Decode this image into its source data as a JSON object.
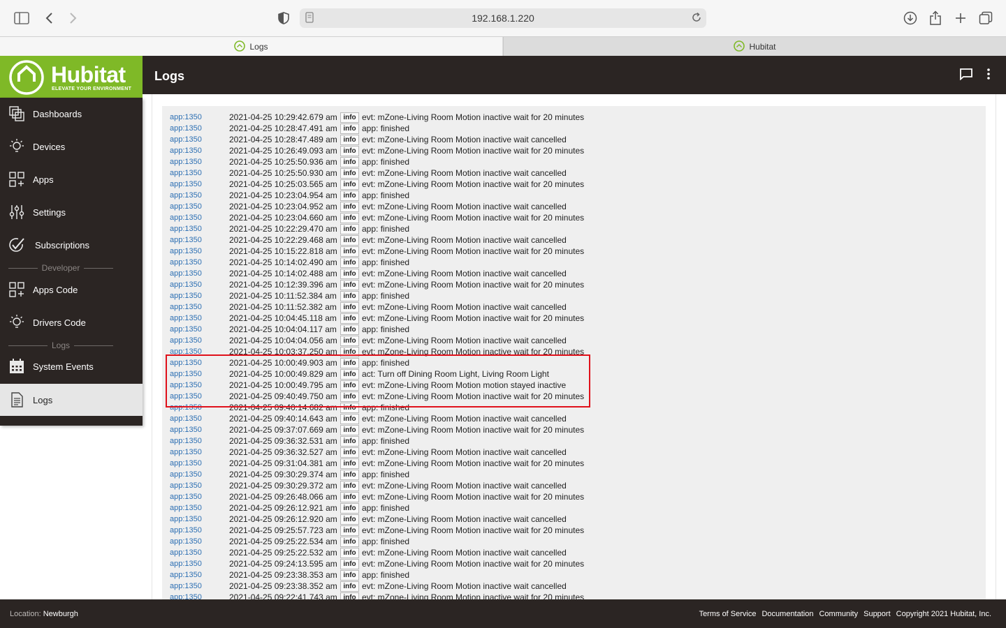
{
  "browser": {
    "url": "192.168.1.220",
    "tabs": [
      {
        "label": "Logs",
        "active": true
      },
      {
        "label": "Hubitat",
        "active": false
      }
    ]
  },
  "header": {
    "logo_text": "Hubitat",
    "logo_tagline": "ELEVATE YOUR ENVIRONMENT",
    "page_title": "Logs",
    "brand_color": "#7fb927"
  },
  "sidebar": {
    "items": [
      {
        "label": "Dashboards",
        "icon": "dashboards-icon"
      },
      {
        "label": "Devices",
        "icon": "bulb-icon"
      },
      {
        "label": "Apps",
        "icon": "apps-grid-icon"
      },
      {
        "label": "Settings",
        "icon": "sliders-icon"
      },
      {
        "label": "Subscriptions",
        "icon": "checkmark-icon"
      },
      {
        "label": "Apps Code",
        "icon": "apps-code-icon"
      },
      {
        "label": "Drivers Code",
        "icon": "bulb-icon"
      },
      {
        "label": "System Events",
        "icon": "calendar-icon"
      },
      {
        "label": "Logs",
        "icon": "document-icon"
      }
    ],
    "sections": [
      "Developer",
      "Logs"
    ]
  },
  "logs": [
    {
      "source": "app:1350",
      "time": "2021-04-25 10:29:42.679 am",
      "level": "info",
      "message": "evt: mZone-Living Room Motion inactive wait for 20 minutes"
    },
    {
      "source": "app:1350",
      "time": "2021-04-25 10:28:47.491 am",
      "level": "info",
      "message": "app: finished"
    },
    {
      "source": "app:1350",
      "time": "2021-04-25 10:28:47.489 am",
      "level": "info",
      "message": "evt: mZone-Living Room Motion inactive wait cancelled"
    },
    {
      "source": "app:1350",
      "time": "2021-04-25 10:26:49.093 am",
      "level": "info",
      "message": "evt: mZone-Living Room Motion inactive wait for 20 minutes"
    },
    {
      "source": "app:1350",
      "time": "2021-04-25 10:25:50.936 am",
      "level": "info",
      "message": "app: finished"
    },
    {
      "source": "app:1350",
      "time": "2021-04-25 10:25:50.930 am",
      "level": "info",
      "message": "evt: mZone-Living Room Motion inactive wait cancelled"
    },
    {
      "source": "app:1350",
      "time": "2021-04-25 10:25:03.565 am",
      "level": "info",
      "message": "evt: mZone-Living Room Motion inactive wait for 20 minutes"
    },
    {
      "source": "app:1350",
      "time": "2021-04-25 10:23:04.954 am",
      "level": "info",
      "message": "app: finished"
    },
    {
      "source": "app:1350",
      "time": "2021-04-25 10:23:04.952 am",
      "level": "info",
      "message": "evt: mZone-Living Room Motion inactive wait cancelled"
    },
    {
      "source": "app:1350",
      "time": "2021-04-25 10:23:04.660 am",
      "level": "info",
      "message": "evt: mZone-Living Room Motion inactive wait for 20 minutes"
    },
    {
      "source": "app:1350",
      "time": "2021-04-25 10:22:29.470 am",
      "level": "info",
      "message": "app: finished"
    },
    {
      "source": "app:1350",
      "time": "2021-04-25 10:22:29.468 am",
      "level": "info",
      "message": "evt: mZone-Living Room Motion inactive wait cancelled"
    },
    {
      "source": "app:1350",
      "time": "2021-04-25 10:15:22.818 am",
      "level": "info",
      "message": "evt: mZone-Living Room Motion inactive wait for 20 minutes"
    },
    {
      "source": "app:1350",
      "time": "2021-04-25 10:14:02.490 am",
      "level": "info",
      "message": "app: finished"
    },
    {
      "source": "app:1350",
      "time": "2021-04-25 10:14:02.488 am",
      "level": "info",
      "message": "evt: mZone-Living Room Motion inactive wait cancelled"
    },
    {
      "source": "app:1350",
      "time": "2021-04-25 10:12:39.396 am",
      "level": "info",
      "message": "evt: mZone-Living Room Motion inactive wait for 20 minutes"
    },
    {
      "source": "app:1350",
      "time": "2021-04-25 10:11:52.384 am",
      "level": "info",
      "message": "app: finished"
    },
    {
      "source": "app:1350",
      "time": "2021-04-25 10:11:52.382 am",
      "level": "info",
      "message": "evt: mZone-Living Room Motion inactive wait cancelled"
    },
    {
      "source": "app:1350",
      "time": "2021-04-25 10:04:45.118 am",
      "level": "info",
      "message": "evt: mZone-Living Room Motion inactive wait for 20 minutes"
    },
    {
      "source": "app:1350",
      "time": "2021-04-25 10:04:04.117 am",
      "level": "info",
      "message": "app: finished"
    },
    {
      "source": "app:1350",
      "time": "2021-04-25 10:04:04.056 am",
      "level": "info",
      "message": "evt: mZone-Living Room Motion inactive wait cancelled"
    },
    {
      "source": "app:1350",
      "time": "2021-04-25 10:03:37.250 am",
      "level": "info",
      "message": "evt: mZone-Living Room Motion inactive wait for 20 minutes"
    },
    {
      "source": "app:1350",
      "time": "2021-04-25 10:00:49.903 am",
      "level": "info",
      "message": "app: finished"
    },
    {
      "source": "app:1350",
      "time": "2021-04-25 10:00:49.829 am",
      "level": "info",
      "message": "act: Turn off Dining Room Light, Living Room Light"
    },
    {
      "source": "app:1350",
      "time": "2021-04-25 10:00:49.795 am",
      "level": "info",
      "message": "evt: mZone-Living Room Motion motion stayed inactive"
    },
    {
      "source": "app:1350",
      "time": "2021-04-25 09:40:49.750 am",
      "level": "info",
      "message": "evt: mZone-Living Room Motion inactive wait for 20 minutes"
    },
    {
      "source": "app:1350",
      "time": "2021-04-25 09:40:14.682 am",
      "level": "info",
      "message": "app: finished"
    },
    {
      "source": "app:1350",
      "time": "2021-04-25 09:40:14.643 am",
      "level": "info",
      "message": "evt: mZone-Living Room Motion inactive wait cancelled"
    },
    {
      "source": "app:1350",
      "time": "2021-04-25 09:37:07.669 am",
      "level": "info",
      "message": "evt: mZone-Living Room Motion inactive wait for 20 minutes"
    },
    {
      "source": "app:1350",
      "time": "2021-04-25 09:36:32.531 am",
      "level": "info",
      "message": "app: finished"
    },
    {
      "source": "app:1350",
      "time": "2021-04-25 09:36:32.527 am",
      "level": "info",
      "message": "evt: mZone-Living Room Motion inactive wait cancelled"
    },
    {
      "source": "app:1350",
      "time": "2021-04-25 09:31:04.381 am",
      "level": "info",
      "message": "evt: mZone-Living Room Motion inactive wait for 20 minutes"
    },
    {
      "source": "app:1350",
      "time": "2021-04-25 09:30:29.374 am",
      "level": "info",
      "message": "app: finished"
    },
    {
      "source": "app:1350",
      "time": "2021-04-25 09:30:29.372 am",
      "level": "info",
      "message": "evt: mZone-Living Room Motion inactive wait cancelled"
    },
    {
      "source": "app:1350",
      "time": "2021-04-25 09:26:48.066 am",
      "level": "info",
      "message": "evt: mZone-Living Room Motion inactive wait for 20 minutes"
    },
    {
      "source": "app:1350",
      "time": "2021-04-25 09:26:12.921 am",
      "level": "info",
      "message": "app: finished"
    },
    {
      "source": "app:1350",
      "time": "2021-04-25 09:26:12.920 am",
      "level": "info",
      "message": "evt: mZone-Living Room Motion inactive wait cancelled"
    },
    {
      "source": "app:1350",
      "time": "2021-04-25 09:25:57.723 am",
      "level": "info",
      "message": "evt: mZone-Living Room Motion inactive wait for 20 minutes"
    },
    {
      "source": "app:1350",
      "time": "2021-04-25 09:25:22.534 am",
      "level": "info",
      "message": "app: finished"
    },
    {
      "source": "app:1350",
      "time": "2021-04-25 09:25:22.532 am",
      "level": "info",
      "message": "evt: mZone-Living Room Motion inactive wait cancelled"
    },
    {
      "source": "app:1350",
      "time": "2021-04-25 09:24:13.595 am",
      "level": "info",
      "message": "evt: mZone-Living Room Motion inactive wait for 20 minutes"
    },
    {
      "source": "app:1350",
      "time": "2021-04-25 09:23:38.353 am",
      "level": "info",
      "message": "app: finished"
    },
    {
      "source": "app:1350",
      "time": "2021-04-25 09:23:38.352 am",
      "level": "info",
      "message": "evt: mZone-Living Room Motion inactive wait cancelled"
    },
    {
      "source": "app:1350",
      "time": "2021-04-25 09:22:41.743 am",
      "level": "info",
      "message": "evt: mZone-Living Room Motion inactive wait for 20 minutes"
    }
  ],
  "footer": {
    "location_label": "Location:",
    "location_value": "Newburgh",
    "links": [
      "Terms of Service",
      "Documentation",
      "Community",
      "Support"
    ],
    "copyright": "Copyright 2021 Hubitat, Inc."
  }
}
